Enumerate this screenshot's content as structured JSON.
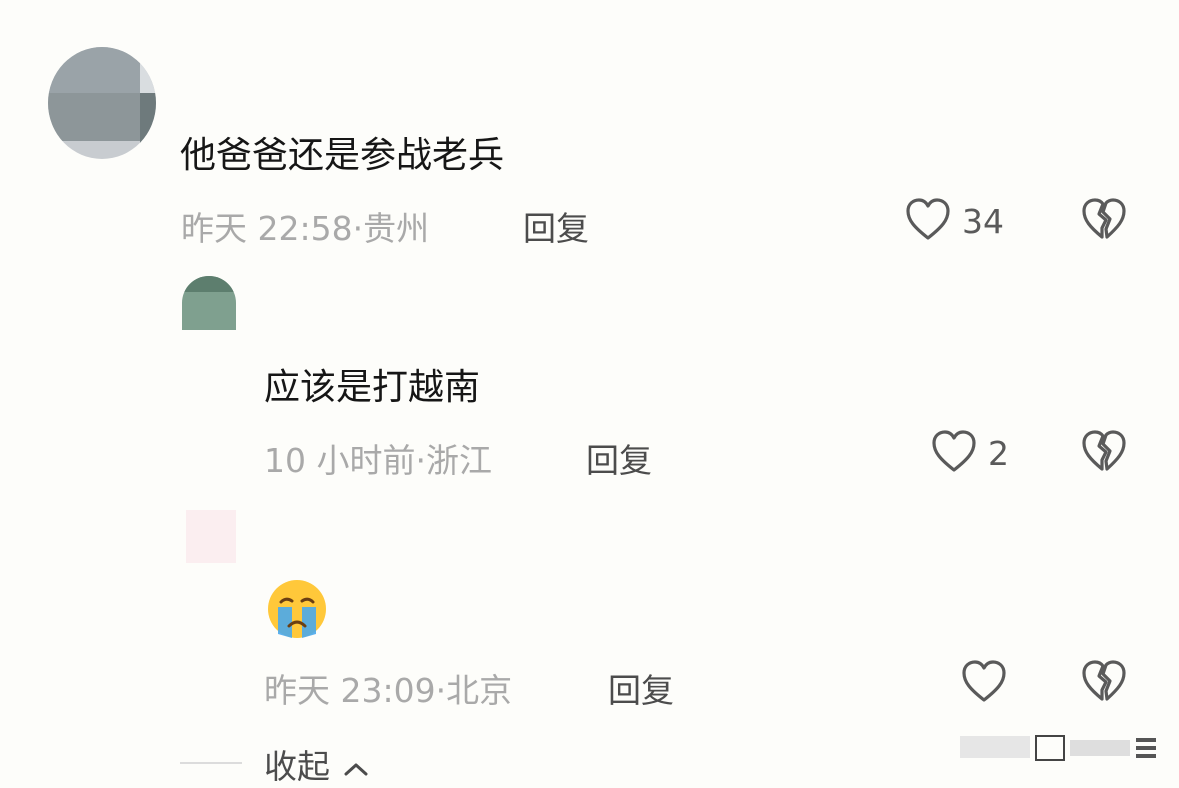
{
  "comments": [
    {
      "text": "他爸爸还是参战老兵",
      "time": "昨天 22:58",
      "location": "贵州",
      "reply_label": "回复",
      "likes": "34"
    },
    {
      "text": "应该是打越南",
      "time": "10 小时前",
      "location": "浙江",
      "reply_label": "回复",
      "likes": "2"
    },
    {
      "emoji_icon": "loudly-crying-face-icon",
      "time": "昨天 23:09",
      "location": "北京",
      "reply_label": "回复",
      "likes": ""
    }
  ],
  "separator": "·",
  "collapse_label": "收起",
  "colors": {
    "text": "#161616",
    "meta": "#a9a9a9",
    "reply": "#4c4c4c",
    "icon": "#5a5a5a",
    "background": "#fdfdfa"
  }
}
